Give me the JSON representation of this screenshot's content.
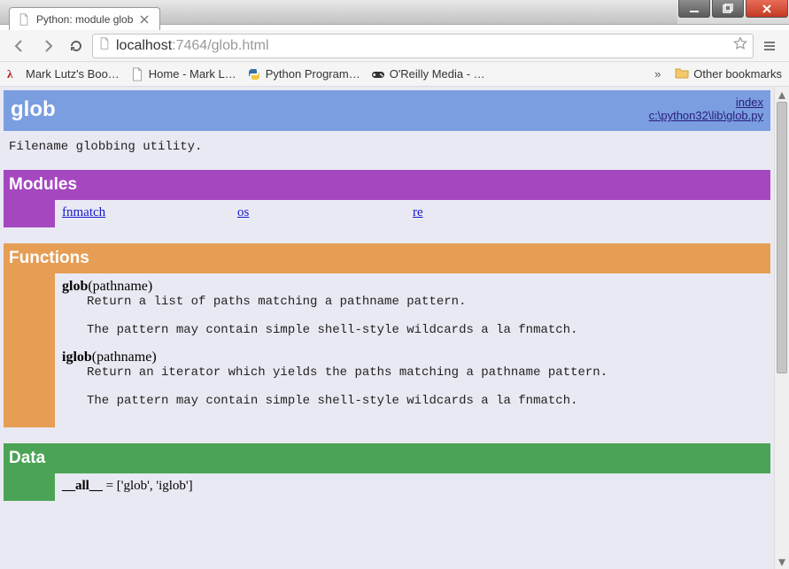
{
  "window": {
    "minimize_tip": "Minimize",
    "maximize_tip": "Restore",
    "close_tip": "Close"
  },
  "tab": {
    "title": "Python: module glob"
  },
  "nav": {
    "back_tip": "Back",
    "forward_tip": "Forward",
    "reload_tip": "Reload"
  },
  "omnibox": {
    "host": "localhost",
    "rest": ":7464/glob.html",
    "star_tip": "Bookmark this page"
  },
  "menu": {
    "tip": "Customize and control"
  },
  "bookmarks": {
    "items": [
      {
        "label": "Mark Lutz's Boo…",
        "icon": "lambda"
      },
      {
        "label": "Home - Mark L…",
        "icon": "page"
      },
      {
        "label": "Python Program…",
        "icon": "python"
      },
      {
        "label": "O'Reilly Media - …",
        "icon": "controller"
      }
    ],
    "overflow_tip": "»",
    "other_label": "Other bookmarks"
  },
  "doc": {
    "title": "glob",
    "index_label": "index",
    "source_path": "c:\\python32\\lib\\glob.py",
    "description": "Filename globbing utility.",
    "sections": {
      "modules": {
        "heading": "Modules",
        "items": [
          "fnmatch",
          "os",
          "re"
        ]
      },
      "functions": {
        "heading": "Functions",
        "items": [
          {
            "name": "glob",
            "sig": "(pathname)",
            "doc": "Return a list of paths matching a pathname pattern.\n\nThe pattern may contain simple shell-style wildcards a la fnmatch."
          },
          {
            "name": "iglob",
            "sig": "(pathname)",
            "doc": "Return an iterator which yields the paths matching a pathname pattern.\n\nThe pattern may contain simple shell-style wildcards a la fnmatch."
          }
        ]
      },
      "data": {
        "heading": "Data",
        "items": [
          {
            "name": "__all__",
            "value": " = ['glob', 'iglob']"
          }
        ]
      }
    }
  }
}
